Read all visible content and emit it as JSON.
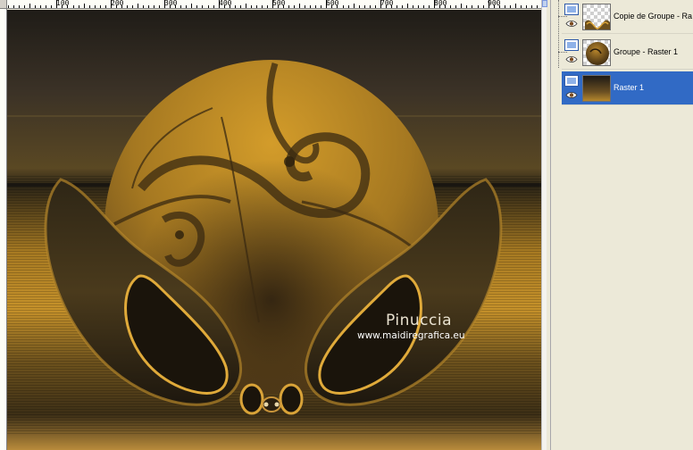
{
  "ruler": {
    "labels": [
      "100",
      "200",
      "300",
      "400",
      "500",
      "600",
      "700",
      "800",
      "900"
    ]
  },
  "watermark": {
    "title": "Pinuccia",
    "url": "www.maidiregrafica.eu"
  },
  "layers": [
    {
      "name": "Copie de Groupe - Ra",
      "thumbnail": "checker-swirl",
      "selected": false
    },
    {
      "name": "Groupe - Raster 1",
      "thumbnail": "checker-ball",
      "selected": false
    },
    {
      "name": "Raster 1",
      "thumbnail": "gradient",
      "selected": true
    }
  ],
  "colors": {
    "selection": "#316ac5",
    "gold": "#c89a2e",
    "dark_brown": "#2a2418"
  }
}
